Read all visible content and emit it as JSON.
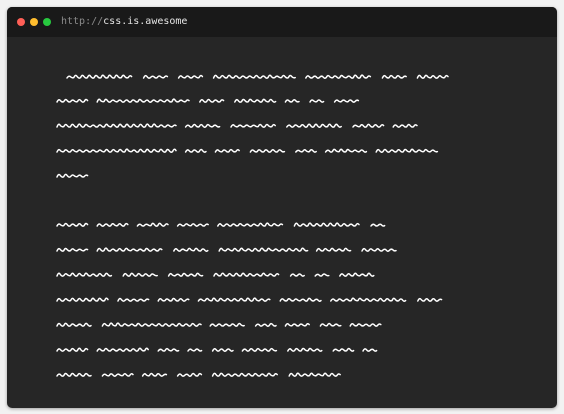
{
  "window": {
    "url_protocol": "http://",
    "url_host": "css.is.awesome"
  },
  "colors": {
    "page_background": "#f2f2f2",
    "window_background": "#262626",
    "titlebar_background": "#191919",
    "close": "#ff5f56",
    "minimize": "#ffbd2e",
    "maximize": "#27c93f",
    "scribble": "#ffffff"
  },
  "content": {
    "style": "handwritten scribble (illegible)",
    "paragraphs": [
      {
        "words": [
          [
            13,
            1.0
          ],
          [
            5,
            0.8
          ],
          [
            5,
            0.8
          ],
          [
            16,
            1.0
          ],
          [
            13,
            1.0
          ],
          [
            5,
            0.8
          ],
          [
            6,
            0.9
          ]
        ],
        "lines": 7
      },
      {
        "words": [
          [
            6,
            0.9
          ],
          [
            18,
            1.0
          ],
          [
            5,
            0.8
          ],
          [
            8,
            0.9
          ],
          [
            3,
            0.7
          ],
          [
            3,
            0.7
          ],
          [
            5,
            0.8
          ]
        ]
      },
      {
        "words": [
          [
            23,
            1.0
          ],
          [
            7,
            0.9
          ],
          [
            9,
            0.9
          ],
          [
            11,
            1.0
          ],
          [
            6,
            0.9
          ],
          [
            5,
            0.8
          ]
        ]
      },
      {
        "words": [
          [
            23,
            1.0
          ],
          [
            4,
            0.8
          ],
          [
            5,
            0.8
          ],
          [
            7,
            0.9
          ],
          [
            4,
            0.8
          ],
          [
            8,
            0.9
          ],
          [
            12,
            1.0
          ]
        ]
      },
      {
        "words": [
          [
            6,
            0.9
          ]
        ]
      }
    ]
  }
}
